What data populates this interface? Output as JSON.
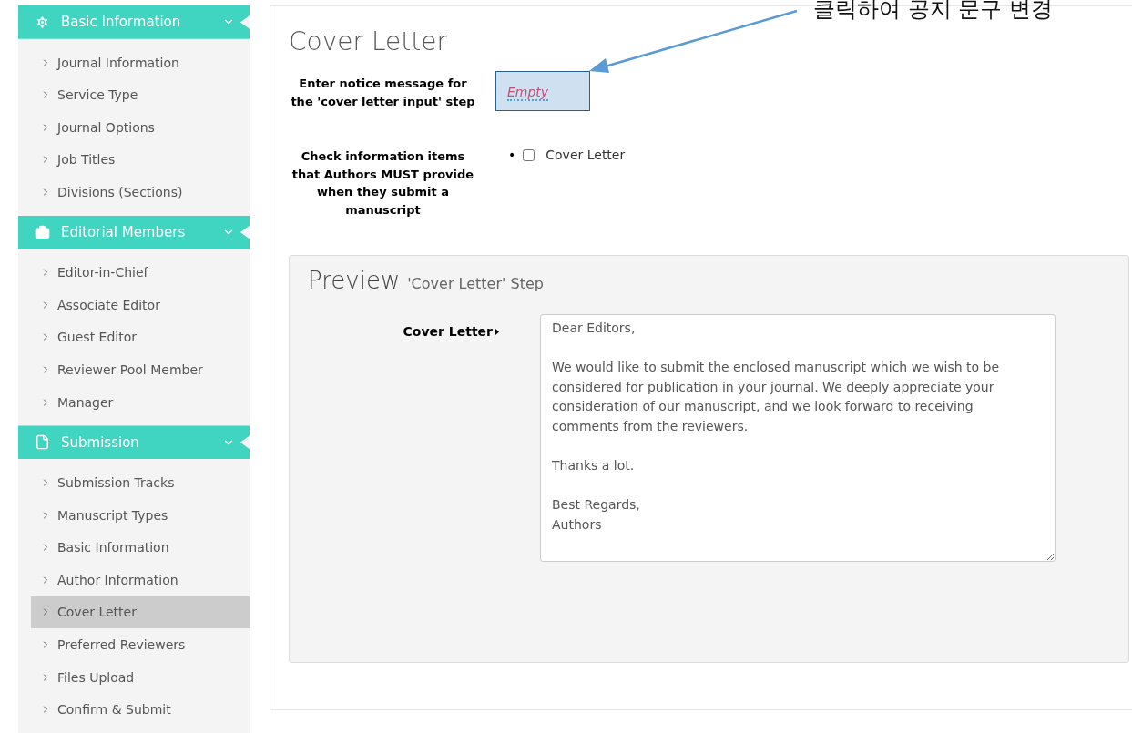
{
  "sidebar": {
    "sections": [
      {
        "title": "Basic Information",
        "expanded": true,
        "items": [
          {
            "label": "Journal Information",
            "selected": false
          },
          {
            "label": "Service Type",
            "selected": false
          },
          {
            "label": "Journal Options",
            "selected": false
          },
          {
            "label": "Job Titles",
            "selected": false
          },
          {
            "label": "Divisions (Sections)",
            "selected": false
          }
        ]
      },
      {
        "title": "Editorial Members",
        "expanded": true,
        "items": [
          {
            "label": "Editor-in-Chief",
            "selected": false
          },
          {
            "label": "Associate Editor",
            "selected": false
          },
          {
            "label": "Guest Editor",
            "selected": false
          },
          {
            "label": "Reviewer Pool Member",
            "selected": false
          },
          {
            "label": "Manager",
            "selected": false
          }
        ]
      },
      {
        "title": "Submission",
        "expanded": true,
        "items": [
          {
            "label": "Submission Tracks",
            "selected": false
          },
          {
            "label": "Manuscript Types",
            "selected": false
          },
          {
            "label": "Basic Information",
            "selected": false
          },
          {
            "label": "Author Information",
            "selected": false
          },
          {
            "label": "Cover Letter",
            "selected": true
          },
          {
            "label": "Preferred Reviewers",
            "selected": false
          },
          {
            "label": "Files Upload",
            "selected": false
          },
          {
            "label": "Confirm & Submit",
            "selected": false
          }
        ]
      }
    ]
  },
  "main": {
    "title": "Cover Letter",
    "notice": {
      "label": "Enter notice message for the 'cover letter input' step",
      "placeholder": "Empty"
    },
    "required_items": {
      "label": "Check information items that Authors MUST provide when they submit a manuscript",
      "options": [
        {
          "marker": "•",
          "label": "Cover Letter",
          "checked": false
        }
      ]
    },
    "preview": {
      "title": "Preview",
      "subtitle": "'Cover Letter' Step",
      "field_label": "Cover Letter",
      "value": "Dear Editors,\n\nWe would like to submit the enclosed manuscript which we wish to be considered for publication in your journal. We deeply appreciate your consideration of our manuscript, and we look forward to receiving comments from the reviewers.\n\nThanks a lot.\n\nBest Regards,\nAuthors"
    }
  },
  "annotation": {
    "text": "클릭하여 공지 문구 변경"
  }
}
